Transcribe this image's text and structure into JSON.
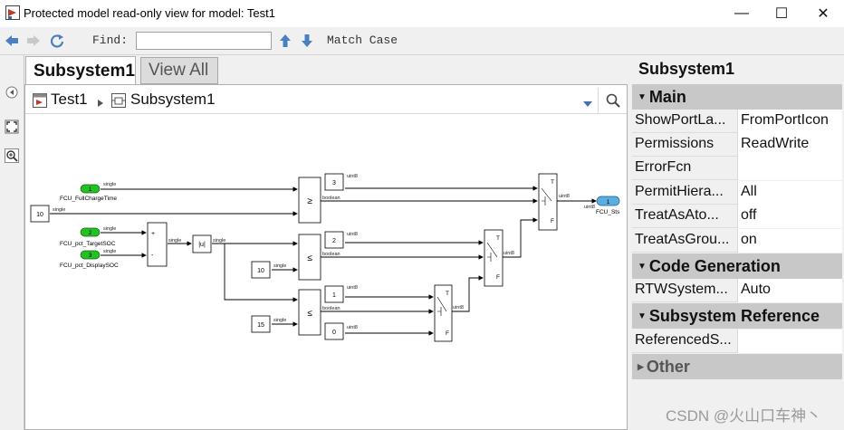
{
  "window": {
    "title": "Protected model read-only view for model: Test1",
    "minimize": "—",
    "maximize": "☐",
    "close": "✕"
  },
  "toolbar": {
    "find_label": "Find:",
    "find_value": "",
    "match_case": "Match Case"
  },
  "tabs": [
    {
      "label": "Subsystem1",
      "active": true
    },
    {
      "label": "View All",
      "active": false
    }
  ],
  "breadcrumb": {
    "root": "Test1",
    "current": "Subsystem1"
  },
  "properties": {
    "header": "Subsystem1",
    "main": {
      "title": "Main",
      "rows": [
        {
          "name": "ShowPortLa...",
          "value": "FromPortIcon"
        },
        {
          "name": "Permissions",
          "value": "ReadWrite"
        },
        {
          "name": "ErrorFcn",
          "value": ""
        },
        {
          "name": "PermitHiera...",
          "value": "All"
        },
        {
          "name": "TreatAsAto...",
          "value": "off"
        },
        {
          "name": "TreatAsGrou...",
          "value": "on"
        }
      ]
    },
    "codegen": {
      "title": "Code Generation",
      "rows": [
        {
          "name": "RTWSystem...",
          "value": "Auto"
        }
      ]
    },
    "subsysref": {
      "title": "Subsystem Reference",
      "rows": [
        {
          "name": "ReferencedS...",
          "value": ""
        }
      ]
    },
    "other": {
      "title": "Other"
    }
  },
  "diagram": {
    "inports": [
      {
        "num": "1",
        "name": "FCU_FullChargeTime"
      },
      {
        "num": "2",
        "name": "FCU_pct_TargetSOC"
      },
      {
        "num": "3",
        "name": "FCU_pct_DisplaySOC"
      }
    ],
    "outport": {
      "num": "1",
      "name": "FCU_Sts"
    },
    "constants": [
      "10",
      "10",
      "15",
      "3",
      "2",
      "1",
      "0"
    ],
    "relops": [
      "≥",
      "≤",
      "≤"
    ],
    "abs_label": "|u|",
    "sum_signs": [
      "+",
      "-"
    ],
    "switch_labels": [
      "T",
      "F"
    ],
    "signal_types": [
      "single",
      "boolean",
      "uint8"
    ]
  },
  "watermark": "CSDN @火山口车神丶"
}
